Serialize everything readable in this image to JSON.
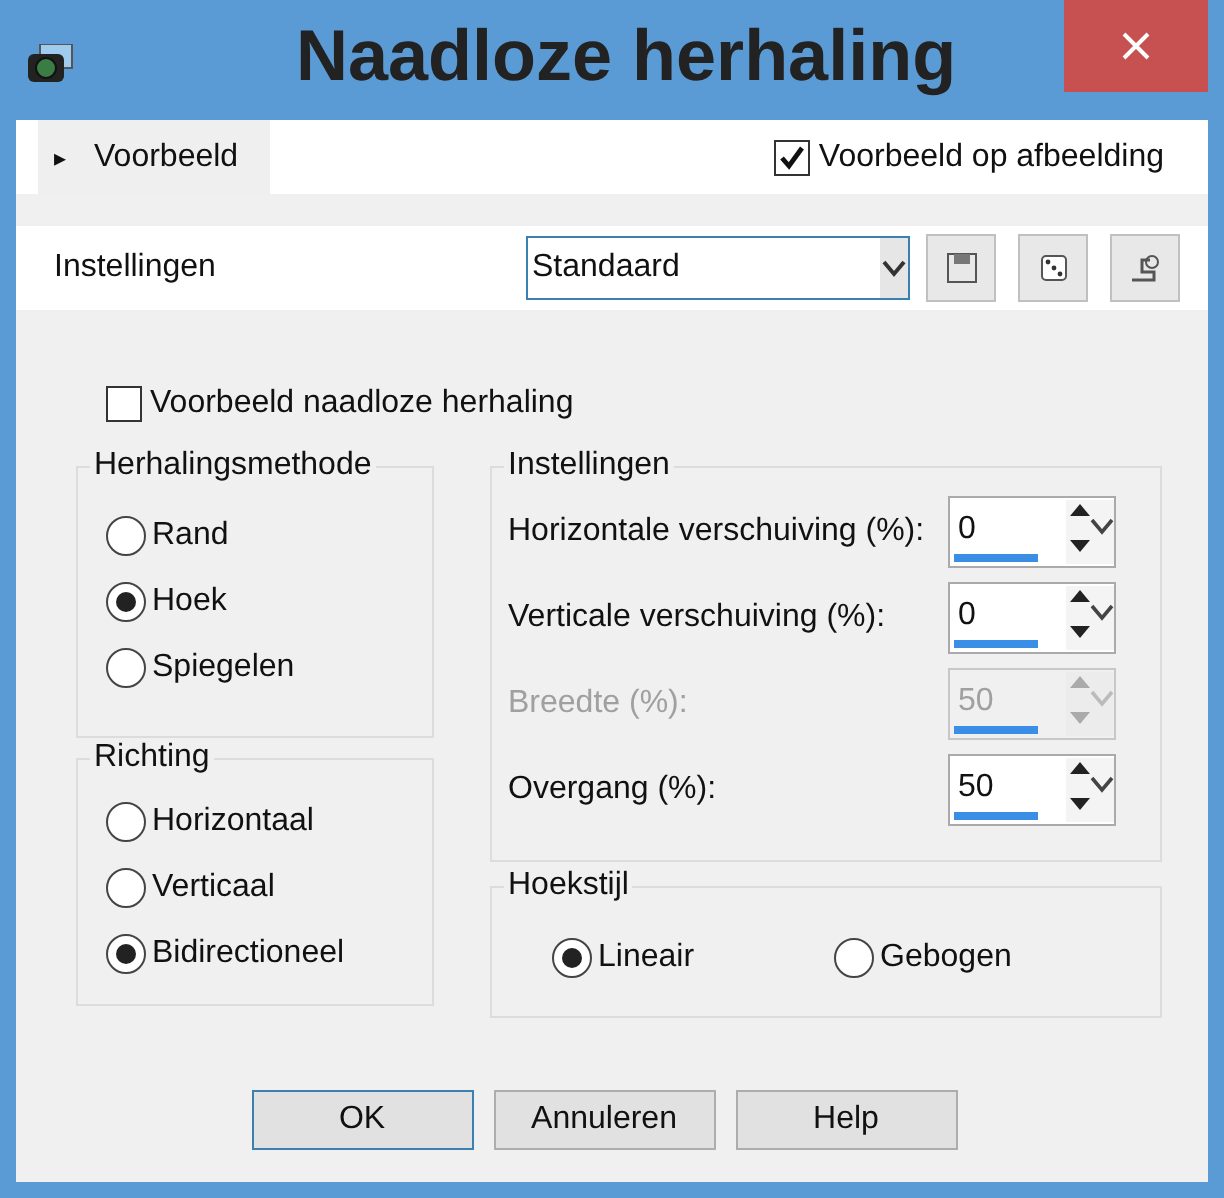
{
  "window": {
    "title": "Naadloze herhaling"
  },
  "preview": {
    "toggle_icon": "▸",
    "label": "Voorbeeld",
    "on_image": {
      "label": "Voorbeeld op afbeelding",
      "checked": true
    }
  },
  "presets": {
    "label": "Instellingen",
    "value": "Standaard"
  },
  "seamless_preview": {
    "label": "Voorbeeld naadloze herhaling",
    "checked": false
  },
  "method": {
    "title": "Herhalingsmethode",
    "options": [
      {
        "label": "Rand",
        "selected": false
      },
      {
        "label": "Hoek",
        "selected": true
      },
      {
        "label": "Spiegelen",
        "selected": false
      }
    ]
  },
  "direction": {
    "title": "Richting",
    "options": [
      {
        "label": "Horizontaal",
        "selected": false
      },
      {
        "label": "Verticaal",
        "selected": false
      },
      {
        "label": "Bidirectioneel",
        "selected": true
      }
    ]
  },
  "settings": {
    "title": "Instellingen",
    "fields": [
      {
        "label": "Horizontale verschuiving (%):",
        "value": "0",
        "disabled": false
      },
      {
        "label": "Verticale verschuiving (%):",
        "value": "0",
        "disabled": false
      },
      {
        "label": "Breedte (%):",
        "value": "50",
        "disabled": true
      },
      {
        "label": "Overgang (%):",
        "value": "50",
        "disabled": false
      }
    ]
  },
  "corner_style": {
    "title": "Hoekstijl",
    "options": [
      {
        "label": "Lineair",
        "selected": true
      },
      {
        "label": "Gebogen",
        "selected": false
      }
    ]
  },
  "buttons": [
    {
      "label": "OK",
      "default": true
    },
    {
      "label": "Annuleren",
      "default": false
    },
    {
      "label": "Help",
      "default": false
    }
  ]
}
